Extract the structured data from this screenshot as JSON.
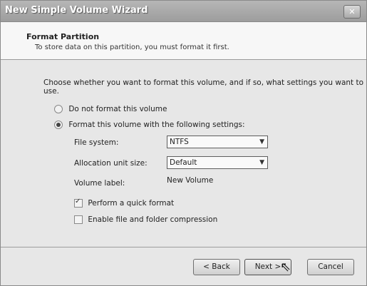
{
  "window": {
    "title": "New Simple Volume Wizard",
    "close_icon": "close-icon"
  },
  "header": {
    "title": "Format Partition",
    "subtitle": "To store data on this partition, you must format it first."
  },
  "main": {
    "intro": "Choose whether you want to format this volume, and if so, what settings you want to use.",
    "radios": [
      {
        "label": "Do not format this volume",
        "checked": false
      },
      {
        "label": "Format this volume with the following settings:",
        "checked": true
      }
    ],
    "file_system": {
      "label": "File system:",
      "value": "NTFS"
    },
    "allocation": {
      "label": "Allocation unit size:",
      "value": "Default"
    },
    "volume_label": {
      "label": "Volume label:",
      "value": "New Volume"
    },
    "checkboxes": [
      {
        "label": "Perform a quick format",
        "checked": true
      },
      {
        "label": "Enable file and folder compression",
        "checked": false
      }
    ]
  },
  "footer": {
    "back": "< Back",
    "next": "Next >",
    "cancel": "Cancel"
  }
}
